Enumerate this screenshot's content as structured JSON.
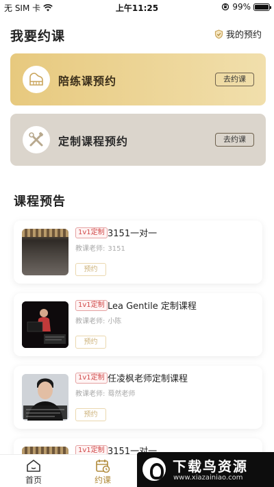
{
  "status_bar": {
    "carrier": "无 SIM 卡",
    "time": "上午11:25",
    "battery_text": "99%",
    "battery_level": 0.99
  },
  "header": {
    "title": "我要约课",
    "my_booking_label": "我的预约"
  },
  "booking_cards": [
    {
      "label": "陪练课预约",
      "button_label": "去约课",
      "icon": "piano-icon"
    },
    {
      "label": "定制课程预约",
      "button_label": "去约课",
      "icon": "tools-icon"
    }
  ],
  "preview": {
    "title": "课程预告",
    "teacher_label": "教课老师:",
    "courses": [
      {
        "tag": "1v1定制",
        "title": "3151一对一",
        "teacher": "3151",
        "button_label": "预约"
      },
      {
        "tag": "1v1定制",
        "title": "Lea Gentile 定制课程",
        "teacher": "小陈",
        "button_label": "预约"
      },
      {
        "tag": "1v1定制",
        "title": "任凌枫老师定制课程",
        "teacher": "蓦然老师",
        "button_label": "预约"
      },
      {
        "tag": "1v1定制",
        "title": "3151一对一"
      }
    ]
  },
  "tabs": [
    {
      "label": "首页",
      "icon": "home-icon",
      "active": false
    },
    {
      "label": "约课",
      "icon": "calendar-clock-icon",
      "active": true
    }
  ],
  "watermark": {
    "title": "下载鸟资源",
    "url": "www.xiazainiao.com"
  },
  "colors": {
    "accent_gold": "#b08a3a",
    "practice_card": "#e7c97e",
    "custom_card": "#dbd5cc",
    "tag_red": "#d04848"
  }
}
